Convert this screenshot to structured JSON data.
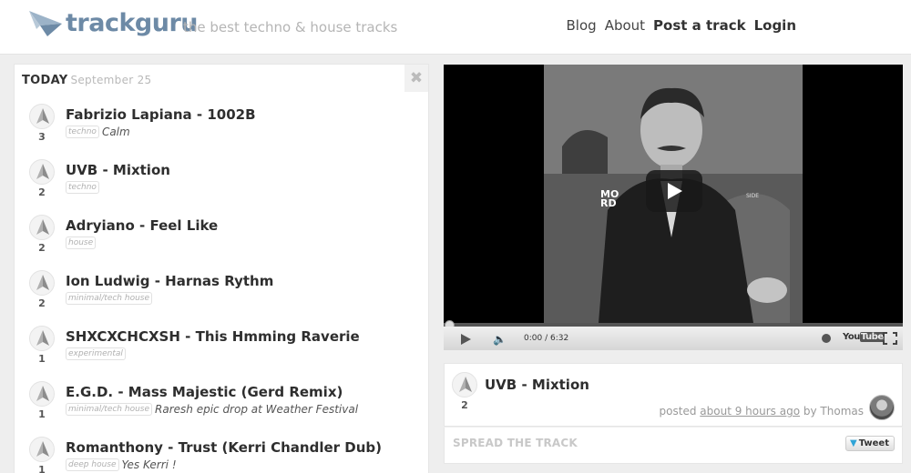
{
  "header": {
    "brand": "trackguru",
    "tagline": "the best techno & house tracks",
    "nav": [
      "Blog",
      "About",
      "Post a track",
      "Login"
    ]
  },
  "list": {
    "heading": "TODAY",
    "date": "September 25",
    "close_icon": "close-icon",
    "tracks": [
      {
        "votes": "3",
        "title": "Fabrizio Lapiana - 1002B",
        "tag": "techno",
        "note": "Calm"
      },
      {
        "votes": "2",
        "title": "UVB - Mixtion",
        "tag": "techno",
        "note": ""
      },
      {
        "votes": "2",
        "title": "Adryiano - Feel Like",
        "tag": "house",
        "note": ""
      },
      {
        "votes": "2",
        "title": "Ion Ludwig - Harnas Rythm",
        "tag": "minimal/tech house",
        "note": ""
      },
      {
        "votes": "1",
        "title": "SHXCXCHCXSH - This Hmming Raverie",
        "tag": "experimental",
        "note": ""
      },
      {
        "votes": "1",
        "title": "E.G.D. - Mass Majestic (Gerd Remix)",
        "tag": "minimal/tech house",
        "note": "Raresh epic drop at Weather Festival"
      },
      {
        "votes": "1",
        "title": "Romanthony - Trust (Kerri Chandler Dub)",
        "tag": "deep house",
        "note": "Yes Kerri !"
      }
    ]
  },
  "player": {
    "time": "0:00 / 6:32",
    "youtube_label_a": "You",
    "youtube_label_b": "Tube",
    "progress": 0
  },
  "current": {
    "votes": "2",
    "title": "UVB - Mixtion",
    "posted_prefix": "posted",
    "posted_time": "about 9 hours ago",
    "posted_by": "by Thomas"
  },
  "share": {
    "label": "SPREAD THE TRACK",
    "tweet": "Tweet"
  },
  "colors": {
    "brand": "#6d8aa6",
    "tag_border": "#e1e1e1",
    "tweet_bird": "#2fa4d7"
  }
}
